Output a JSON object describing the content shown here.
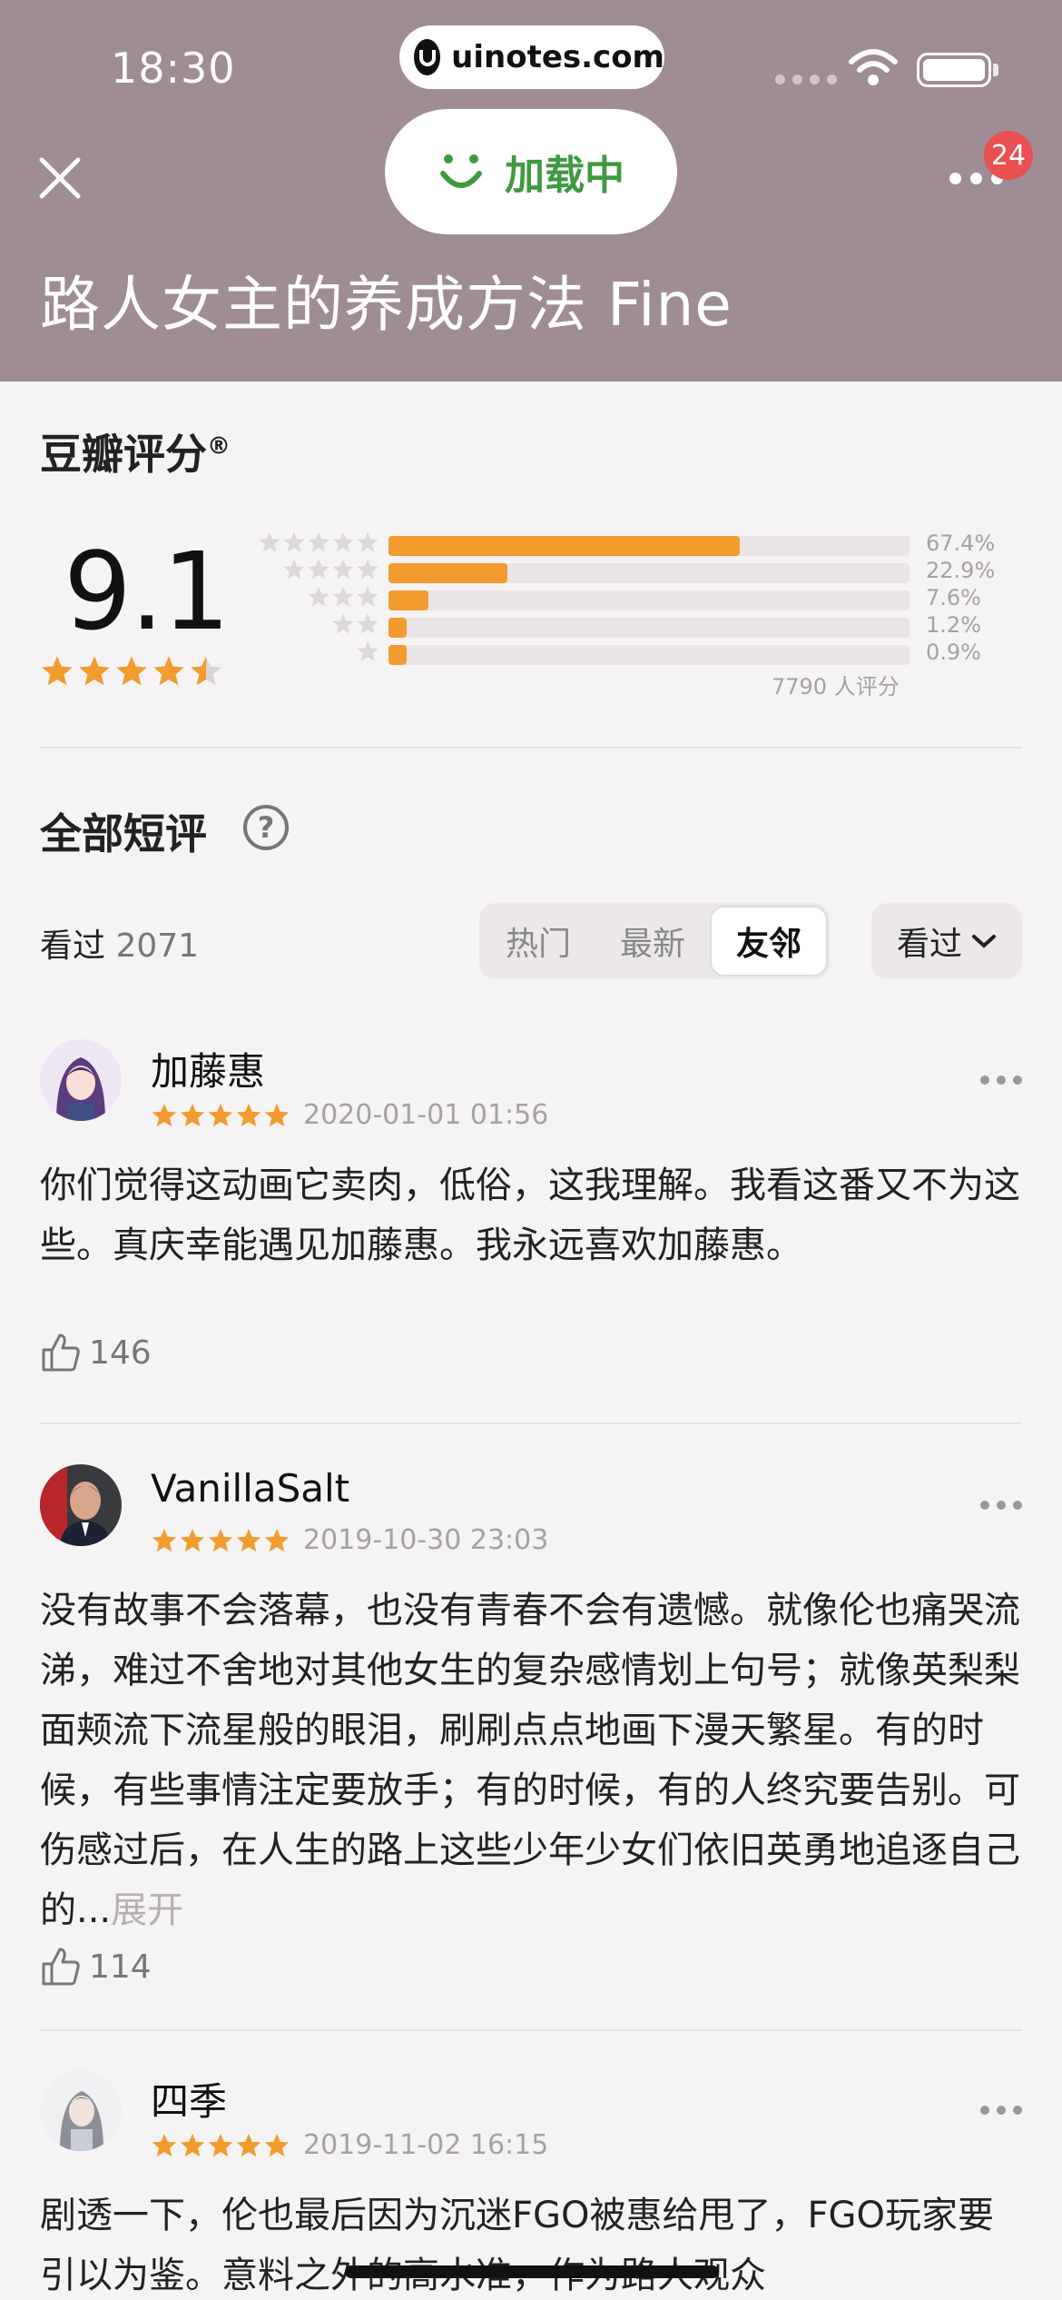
{
  "status_bar": {
    "time": "18:30",
    "url": "uinotes.com"
  },
  "header": {
    "loading_label": "加载中",
    "notification_count": "24",
    "title": "路人女主的养成方法 Fine",
    "bg_color": "#9f8c94"
  },
  "rating": {
    "section_title": "豆瓣评分",
    "registered_mark": "®",
    "score": "9.1",
    "score_stars": 4.5,
    "distribution": [
      {
        "stars": 5,
        "percent": 67.4,
        "label": "67.4%"
      },
      {
        "stars": 4,
        "percent": 22.9,
        "label": "22.9%"
      },
      {
        "stars": 3,
        "percent": 7.6,
        "label": "7.6%"
      },
      {
        "stars": 2,
        "percent": 1.2,
        "label": "1.2%"
      },
      {
        "stars": 1,
        "percent": 0.9,
        "label": "0.9%"
      }
    ],
    "count_label": "7790 人评分",
    "accent_color": "#f29b2f"
  },
  "comments": {
    "section_title": "全部短评",
    "watched_label": "看过",
    "watched_count": "2071",
    "tabs": [
      {
        "label": "热门",
        "active": false
      },
      {
        "label": "最新",
        "active": false
      },
      {
        "label": "友邻",
        "active": true
      }
    ],
    "filter_label": "看过",
    "reviews": [
      {
        "name": "加藤惠",
        "stars": 5,
        "date": "2020-01-01 01:56",
        "text": "你们觉得这动画它卖肉，低俗，这我理解。我看这番又不为这些。真庆幸能遇见加藤惠。我永远喜欢加藤惠。",
        "expand": "",
        "likes": "146"
      },
      {
        "name": "VanillaSalt",
        "stars": 5,
        "date": "2019-10-30 23:03",
        "text": "没有故事不会落幕，也没有青春不会有遗憾。就像伦也痛哭流涕，难过不舍地对其他女生的复杂感情划上句号；就像英梨梨面颊流下流星般的眼泪，刷刷点点地画下漫天繁星。有的时候，有些事情注定要放手；有的时候，有的人终究要告别。可伤感过后，在人生的路上这些少年少女们依旧英勇地追逐自己的...",
        "expand": "展开",
        "likes": "114"
      },
      {
        "name": "四季",
        "stars": 5,
        "date": "2019-11-02 16:15",
        "text": "剧透一下，伦也最后因为沉迷FGO被惠给甩了，FGO玩家要引以为鉴。意料之外的高水准，作为路人观众",
        "expand": "",
        "likes": ""
      }
    ]
  }
}
